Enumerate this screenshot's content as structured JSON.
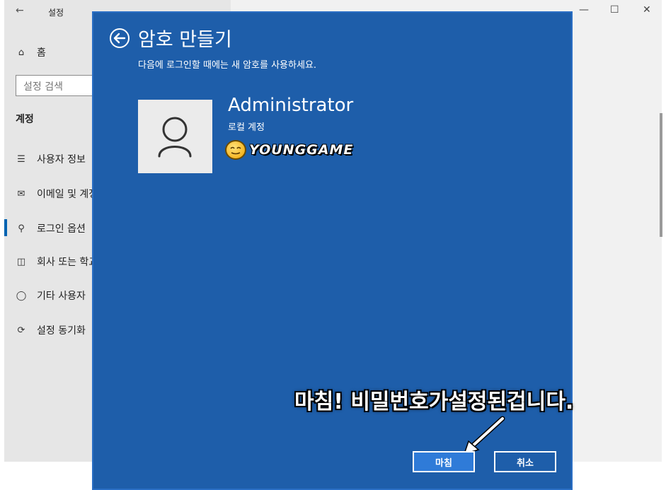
{
  "settings": {
    "title": "설정",
    "nav": {
      "home": "홈",
      "search_placeholder": "설정 검색",
      "section": "계정",
      "items": [
        {
          "label": "사용자 정보",
          "icon": "user-info-icon"
        },
        {
          "label": "이메일 및 계정",
          "icon": "mail-icon"
        },
        {
          "label": "로그인 옵션",
          "icon": "key-icon"
        },
        {
          "label": "회사 또는 학교 액세스",
          "icon": "briefcase-icon"
        },
        {
          "label": "기타 사용자",
          "icon": "add-user-icon"
        },
        {
          "label": "설정 동기화",
          "icon": "sync-icon"
        }
      ]
    }
  },
  "dialog": {
    "title": "암호 만들기",
    "subtitle": "다음에 로그인할 때에는 새 암호를 사용하세요.",
    "account": {
      "name": "Administrator",
      "type": "로컬 계정"
    },
    "watermark": "YOUNGGAME",
    "annotation": "마침! 비밀번호가설정된겁니다.",
    "buttons": {
      "finish": "마침",
      "cancel": "취소"
    }
  },
  "colors": {
    "dialog_bg": "#1e5eaa",
    "accent": "#0063b1"
  }
}
